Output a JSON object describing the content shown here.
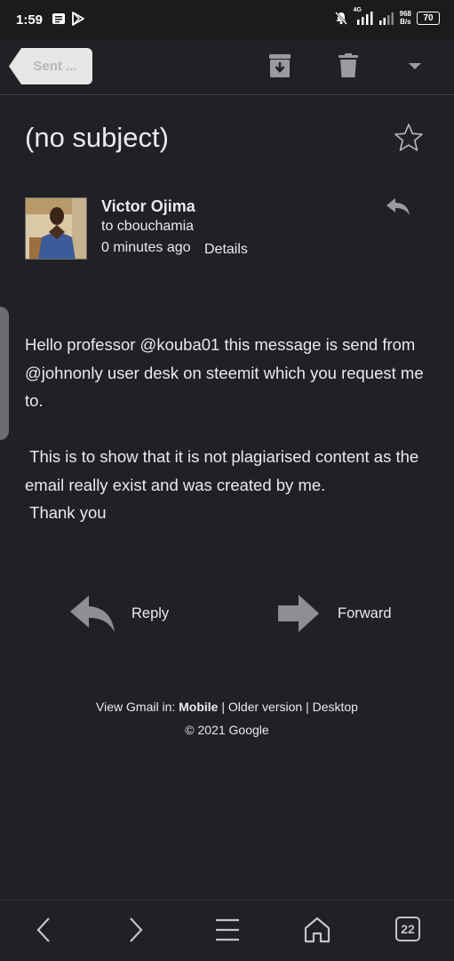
{
  "status_bar": {
    "time": "1:59",
    "network_type": "4G",
    "net_speed_value": "968",
    "net_speed_unit": "B/s",
    "battery": "70"
  },
  "toolbar": {
    "back_label": "Sent ..."
  },
  "email": {
    "subject": "(no subject)",
    "sender_name": "Victor Ojima",
    "recipient": "to cbouchamia",
    "time": "0 minutes ago",
    "details_label": "Details",
    "body": [
      "Hello professor @kouba01 this message is send from @johnonly user desk on steemit which you request me to.",
      " This is to show that it is not plagiarised content as the email really exist and was created by me.",
      " Thank you"
    ]
  },
  "actions": {
    "reply_label": "Reply",
    "forward_label": "Forward"
  },
  "footer": {
    "view_prefix": "View Gmail in:",
    "mobile": "Mobile",
    "separator": "|",
    "older": "Older version",
    "desktop": "Desktop",
    "copyright": "© 2021 Google"
  },
  "navbar": {
    "tabs_count": "22"
  },
  "colors": {
    "background": "#202124",
    "text": "#e8eaed",
    "icon_grey": "#8a8b8e"
  }
}
